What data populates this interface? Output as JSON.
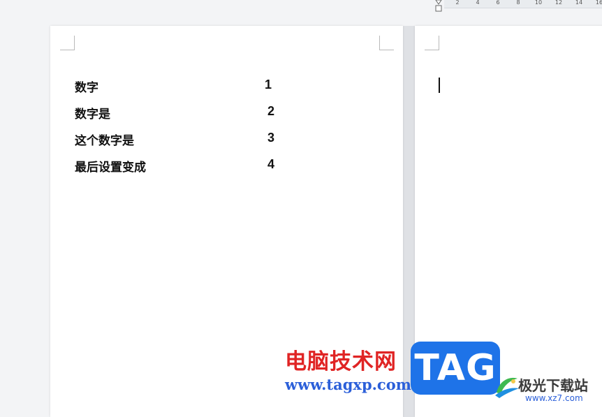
{
  "ruler": {
    "ticks": [
      "2",
      "4",
      "6",
      "8",
      "10",
      "12",
      "14",
      "16"
    ]
  },
  "document": {
    "rows": [
      {
        "label": "数字",
        "number": "1"
      },
      {
        "label": "数字是",
        "number": "2"
      },
      {
        "label": "这个数字是",
        "number": "3"
      },
      {
        "label": "最后设置变成",
        "number": "4"
      }
    ]
  },
  "watermark": {
    "site_name": "电脑技术网",
    "site_url": "www.tagxp.com",
    "badge": "TAG",
    "partner_name": "极光下载站",
    "partner_url": "www.xz7.com"
  },
  "icons": {
    "ruler_marker": "indent-marker-icon",
    "partner_logo": "aurora-logo-icon"
  }
}
